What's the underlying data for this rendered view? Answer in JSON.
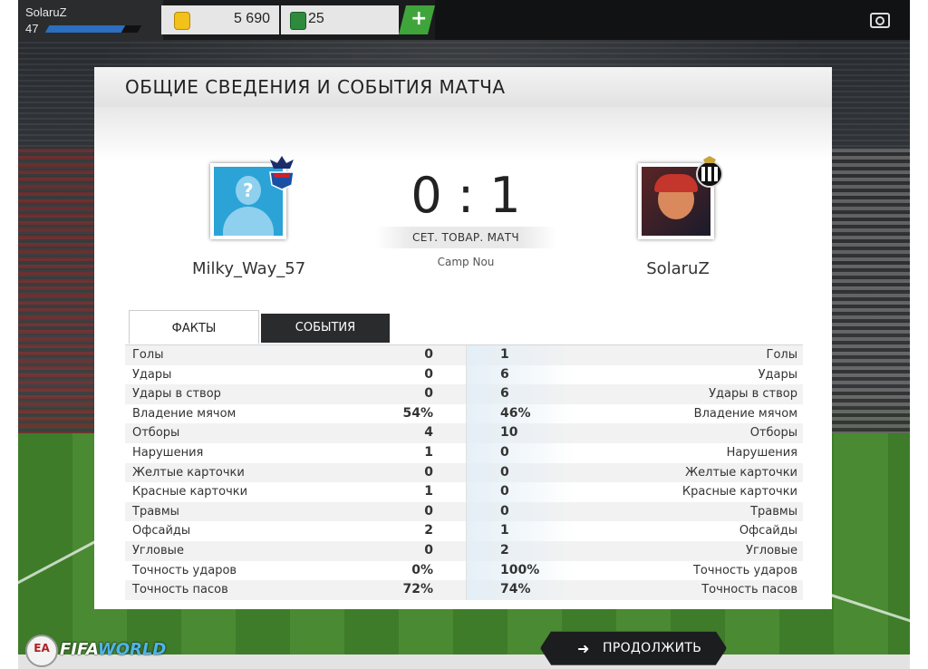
{
  "topbar": {
    "player_name": "SolaruZ",
    "player_level": "47",
    "xp_progress": 0.82,
    "coins": "5 690",
    "points": "25",
    "add_label": "+"
  },
  "panel": {
    "title": "ОБЩИЕ СВЕДЕНИЯ И СОБЫТИЯ МАТЧА"
  },
  "match": {
    "home_name": "Milky_Way_57",
    "away_name": "SolaruZ",
    "score": "0 : 1",
    "type": "СЕТ. ТОВАР. МАТЧ",
    "stadium": "Camp Nou",
    "home_avatar_glyph": "?"
  },
  "tabs": [
    {
      "label": "ФАКТЫ"
    },
    {
      "label": "СОБЫТИЯ"
    }
  ],
  "stats": [
    {
      "label": "Голы",
      "home": "0",
      "away": "1"
    },
    {
      "label": "Удары",
      "home": "0",
      "away": "6"
    },
    {
      "label": "Удары в створ",
      "home": "0",
      "away": "6"
    },
    {
      "label": "Владение мячом",
      "home": "54%",
      "away": "46%"
    },
    {
      "label": "Отборы",
      "home": "4",
      "away": "10"
    },
    {
      "label": "Нарушения",
      "home": "1",
      "away": "0"
    },
    {
      "label": "Желтые карточки",
      "home": "0",
      "away": "0"
    },
    {
      "label": "Красные карточки",
      "home": "1",
      "away": "0"
    },
    {
      "label": "Травмы",
      "home": "0",
      "away": "0"
    },
    {
      "label": "Офсайды",
      "home": "2",
      "away": "1"
    },
    {
      "label": "Угловые",
      "home": "0",
      "away": "2"
    },
    {
      "label": "Точность ударов",
      "home": "0%",
      "away": "100%"
    },
    {
      "label": "Точность пасов",
      "home": "72%",
      "away": "74%"
    }
  ],
  "bottom": {
    "continue_label": "ПРОДОЛЖИТЬ",
    "ea_label": "EA",
    "logo_text_1": "FIFA",
    "logo_text_2": "WORLD"
  },
  "icons": {
    "coin": "coin-icon",
    "points": "fifa-points-icon",
    "camera": "camera-icon",
    "continue_arrow": "arrow-right-icon"
  },
  "colors": {
    "accent_green": "#3fa53a",
    "xp_blue": "#2a6fc0",
    "panel_dark": "#2a2b2d"
  }
}
